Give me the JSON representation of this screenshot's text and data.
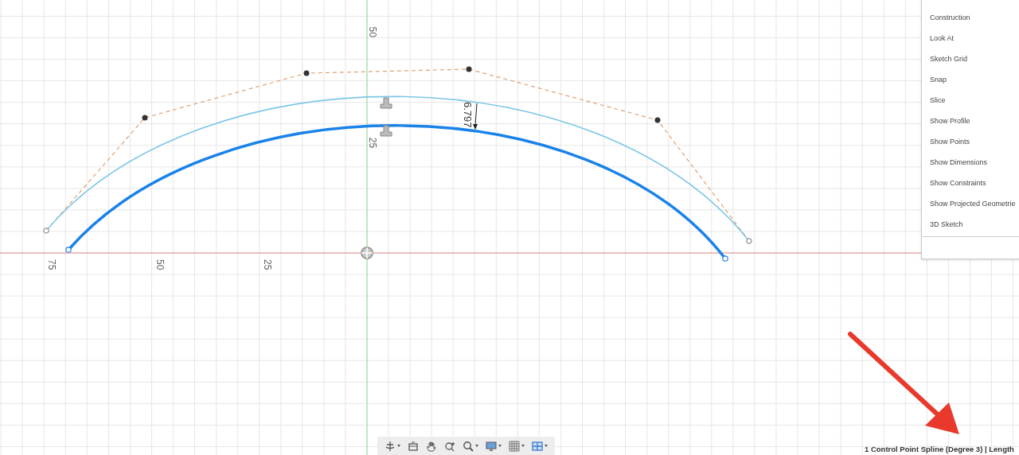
{
  "canvas": {
    "axis_labels": [
      {
        "text": "50",
        "kind": "y"
      },
      {
        "text": "25",
        "kind": "y"
      },
      {
        "text": "75",
        "kind": "x"
      },
      {
        "text": "50",
        "kind": "x"
      },
      {
        "text": "25",
        "kind": "x"
      }
    ],
    "dimension": {
      "text": "6.797"
    }
  },
  "menu": {
    "items": [
      "Construction",
      "Look At",
      "Sketch Grid",
      "Snap",
      "Slice",
      "Show Profile",
      "Show Points",
      "Show Dimensions",
      "Show Constraints",
      "Show Projected Geometrie",
      "3D Sketch"
    ]
  },
  "toolbar": {
    "tools": [
      {
        "kind": "orbit",
        "caret": true
      },
      {
        "kind": "look",
        "caret": false
      },
      {
        "kind": "pan",
        "caret": false
      },
      {
        "kind": "zoomfit",
        "caret": false
      },
      {
        "kind": "zoom",
        "caret": true
      },
      {
        "kind": "display",
        "caret": true
      },
      {
        "kind": "grid",
        "caret": true
      },
      {
        "kind": "viewports",
        "caret": true
      }
    ]
  },
  "status_bar": {
    "text": "1 Control Point Spline (Degree 3) | Length"
  }
}
